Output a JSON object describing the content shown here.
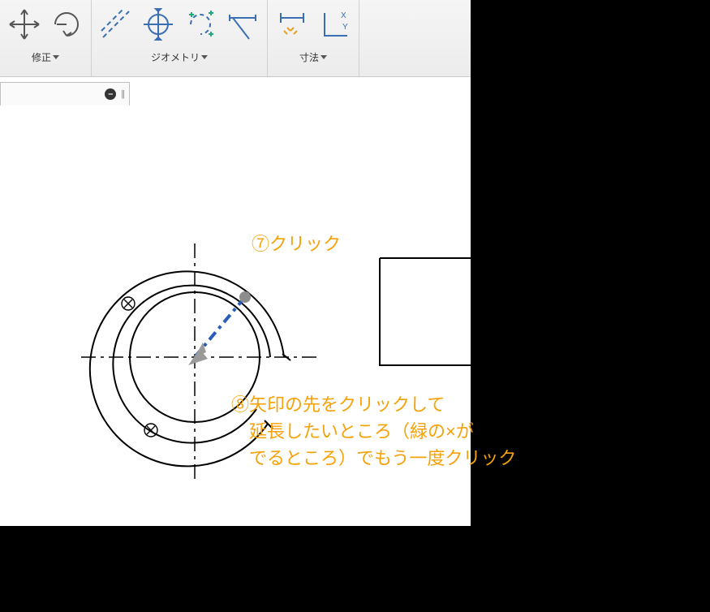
{
  "ribbon": {
    "groups": [
      {
        "label": "修正"
      },
      {
        "label": "ジオメトリ"
      },
      {
        "label": "寸法"
      }
    ]
  },
  "anno": {
    "step7": "⑦クリック",
    "step8_l1": "⑧矢印の先をクリックして",
    "step8_l2": "　延長したいところ（緑の×が",
    "step8_l3": "　でるところ）でもう一度クリック"
  }
}
